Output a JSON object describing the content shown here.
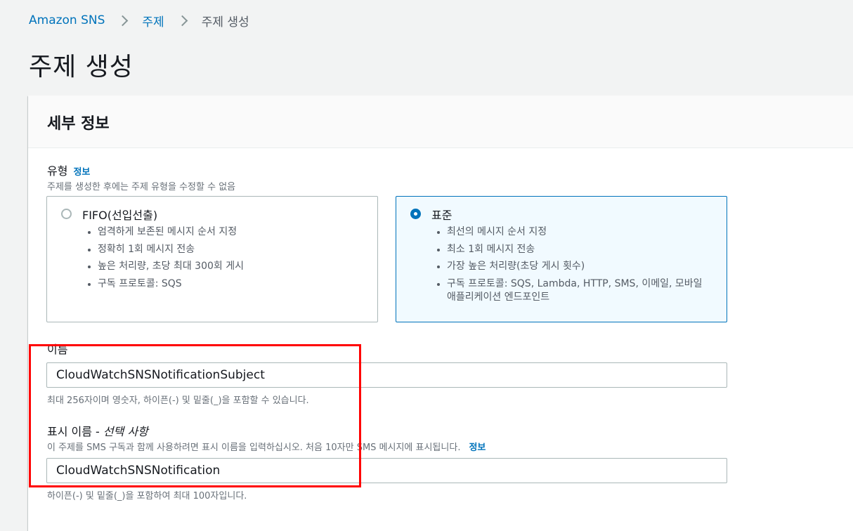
{
  "breadcrumb": {
    "root": "Amazon SNS",
    "topics": "주제",
    "current": "주제 생성"
  },
  "page_title": "주제 생성",
  "details_panel": {
    "title": "세부 정보",
    "type_field": {
      "label": "유형",
      "info": "정보",
      "description": "주제를 생성한 후에는 주제 유형을 수정할 수 없음",
      "options": [
        {
          "label": "FIFO(선입선출)",
          "selected": false,
          "bullets": [
            "엄격하게 보존된 메시지 순서 지정",
            "정확히 1회 메시지 전송",
            "높은 처리량, 초당 최대 300회 게시",
            "구독 프로토콜: SQS"
          ]
        },
        {
          "label": "표준",
          "selected": true,
          "bullets": [
            "최선의 메시지 순서 지정",
            "최소 1회 메시지 전송",
            "가장 높은 처리량(초당 게시 횟수)",
            "구독 프로토콜: SQS, Lambda, HTTP, SMS, 이메일, 모바일 애플리케이션 엔드포인트"
          ]
        }
      ]
    },
    "name_field": {
      "label": "이름",
      "value": "CloudWatchSNSNotificationSubject",
      "hint": "최대 256자이며 영숫자, 하이픈(-) 및 밑줄(_)을 포함할 수 있습니다."
    },
    "display_name_field": {
      "label": "표시 이름 - ",
      "optional": "선택 사항",
      "description": "이 주제를 SMS 구독과 함께 사용하려면 표시 이름을 입력하십시오. 처음 10자만 SMS 메시지에 표시됩니다.",
      "info": "정보",
      "value": "CloudWatchSNSNotification",
      "hint": "하이픈(-) 및 밑줄(_)을 포함하여 최대 100자입니다."
    }
  },
  "colors": {
    "link": "#0073bb",
    "selected_border": "#0073bb",
    "selected_bg": "#f1faff",
    "highlight": "#ff0000"
  }
}
